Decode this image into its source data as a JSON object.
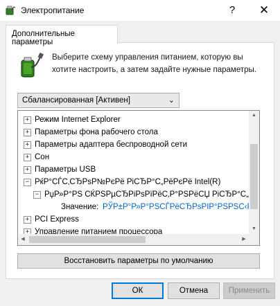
{
  "window": {
    "title": "Электропитание",
    "help_label": "?",
    "close_label": "✕"
  },
  "tab": {
    "label": "Дополнительные параметры"
  },
  "intro": {
    "text": "Выберите схему управления питанием, которую вы хотите настроить, а затем задайте нужные параметры."
  },
  "scheme": {
    "selected": "Сбалансированная [Активен]",
    "arrow": "⌄"
  },
  "tree": {
    "items": [
      {
        "expander": "+",
        "label": "Режим Internet Explorer"
      },
      {
        "expander": "+",
        "label": "Параметры фона рабочего стола"
      },
      {
        "expander": "+",
        "label": "Параметры адаптера беспроводной сети"
      },
      {
        "expander": "+",
        "label": "Сон"
      },
      {
        "expander": "+",
        "label": "Параметры USB"
      },
      {
        "expander": "−",
        "label": "РќР°СЃС‚СЂРѕР№РєРё РіСЂР°С„РёРєРё Intel(R)"
      },
      {
        "expander": "−",
        "label": "РџР»Р°РЅ СЌРЅРµСЂРіРѕРїРёС‚Р°РЅРёСЏ РіСЂР°С„.Р"
      },
      {
        "label": "Значение:",
        "value": "РЎР±Р°Р»Р°РЅСЃРёСЂРѕРІР°РЅРЅС‹Р№"
      },
      {
        "expander": "+",
        "label": "PCI Express"
      },
      {
        "expander": "+",
        "label": "Управление питанием процессора"
      }
    ]
  },
  "buttons": {
    "restore": "Восстановить параметры по умолчанию",
    "ok": "ОК",
    "cancel": "Отмена",
    "apply": "Применить"
  },
  "colors": {
    "link": "#0066cc",
    "default_button_border": "#0078d7"
  },
  "icons": {
    "app": "battery-plug-icon",
    "battery": "battery-charge-icon"
  }
}
